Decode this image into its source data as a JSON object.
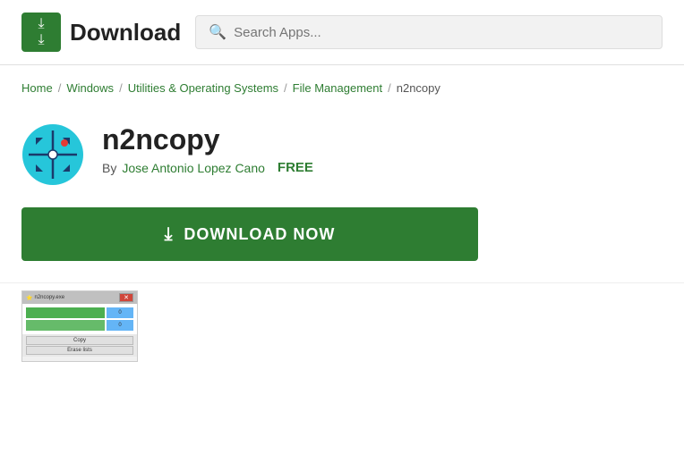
{
  "header": {
    "logo_text": "Download",
    "search_placeholder": "Search Apps..."
  },
  "breadcrumb": {
    "items": [
      {
        "label": "Home",
        "href": "#",
        "is_link": true
      },
      {
        "label": "Windows",
        "href": "#",
        "is_link": true
      },
      {
        "label": "Utilities & Operating Systems",
        "href": "#",
        "is_link": true
      },
      {
        "label": "File Management",
        "href": "#",
        "is_link": true
      },
      {
        "label": "n2ncopy",
        "is_link": false
      }
    ],
    "separator": "/"
  },
  "app": {
    "name": "n2ncopy",
    "author_label": "By",
    "author_name": "Jose Antonio Lopez Cano",
    "price": "FREE",
    "download_btn_label": "DOWNLOAD NOW"
  },
  "screenshot": {
    "title": "n2ncopy.exe",
    "row1_val": "0",
    "row2_val": "0",
    "btn1": "Copy",
    "btn2": "Erase lists"
  },
  "colors": {
    "brand_green": "#2e7d32",
    "free_green": "#2e7d32",
    "link_green": "#2e7d32"
  }
}
